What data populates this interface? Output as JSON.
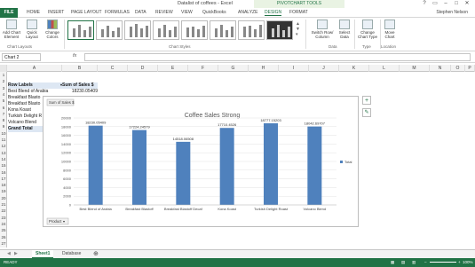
{
  "window": {
    "title": "Datalist of coffees - Excel",
    "pivot_tools_title": "PIVOTCHART TOOLS",
    "controls": [
      "?",
      "▭",
      "–",
      "□",
      "✕"
    ]
  },
  "tabs": {
    "file": "FILE",
    "items": [
      "HOME",
      "INSERT",
      "PAGE LAYOUT",
      "FORMULAS",
      "DATA",
      "REVIEW",
      "VIEW",
      "QuickBooks",
      "ANALYZE",
      "DESIGN",
      "FORMAT"
    ],
    "active": "DESIGN",
    "user": "Stephen Nelson"
  },
  "ribbon": {
    "buttons": [
      {
        "label": "Add Chart Element",
        "icon": "add-chart-element-icon"
      },
      {
        "label": "Quick Layout",
        "icon": "quick-layout-icon"
      },
      {
        "label": "Change Colors",
        "icon": "change-colors-icon"
      },
      {
        "label": "Switch Row/ Column",
        "icon": "switch-row-column-icon"
      },
      {
        "label": "Select Data",
        "icon": "select-data-icon"
      },
      {
        "label": "Change Chart Type",
        "icon": "change-chart-type-icon"
      },
      {
        "label": "Move Chart",
        "icon": "move-chart-icon"
      }
    ],
    "groups": [
      "Chart Layouts",
      "Chart Styles",
      "Data",
      "Type",
      "Location"
    ]
  },
  "formula_bar": {
    "name_box": "Chart 2",
    "fx": "fx",
    "formula": ""
  },
  "columns": [
    "A",
    "B",
    "C",
    "D",
    "E",
    "F",
    "G",
    "H",
    "I",
    "J",
    "K",
    "L",
    "M",
    "N",
    "O",
    "P"
  ],
  "rows": [
    "1",
    "2",
    "3",
    "4",
    "5",
    "6",
    "7",
    "8",
    "9",
    "10",
    "11",
    "12",
    "13",
    "14",
    "15",
    "16",
    "17",
    "18",
    "19",
    "20",
    "21",
    "22",
    "23",
    "24",
    "25",
    "26",
    "27"
  ],
  "pivot_table": {
    "header_label": "Row Labels",
    "header_value": "Sum of Sales $",
    "items": [
      {
        "label": "Best Blend of Arabia",
        "value": "18230.05409"
      },
      {
        "label": "Breakfast Blasto",
        "value": ""
      },
      {
        "label": "Breakfast Blasto",
        "value": ""
      },
      {
        "label": "Kona Koast",
        "value": ""
      },
      {
        "label": "Turkish Delight R",
        "value": ""
      },
      {
        "label": "Volcano Blend",
        "value": ""
      }
    ],
    "grand_total": "Grand Total"
  },
  "chart_data": {
    "type": "bar",
    "title": "Coffee Sales Strong",
    "field_button": "Sum of Sales $",
    "axis_field_button": "Product",
    "legend": [
      "Total"
    ],
    "legend_position": "right",
    "categories": [
      "Best Blend of Arabia",
      "Breakfast Blastoff",
      "Breakfast Blastoff Decaf",
      "Kona Koast",
      "Turkish Delight Roast",
      "Volcano Blend"
    ],
    "data_labels": [
      "18230.05409",
      "17224.24579",
      "14518.06508",
      "17710.4526",
      "18777.15203",
      "18042.69707"
    ],
    "series": [
      {
        "name": "Total",
        "values": [
          18230.05409,
          17224.24579,
          14518.06508,
          17710.4526,
          18777.15203,
          18042.69707
        ]
      }
    ],
    "yticks": [
      "0",
      "2000",
      "4000",
      "6000",
      "8000",
      "10000",
      "12000",
      "14000",
      "16000",
      "18000",
      "20000"
    ],
    "ylim": [
      0,
      20000
    ],
    "bar_color": "#4f81bd"
  },
  "sheet_tabs": [
    "Sheet1",
    "Database"
  ],
  "active_sheet": "Sheet1",
  "status": {
    "ready": "READY",
    "zoom": "100%"
  },
  "colors": {
    "accent": "#217346"
  }
}
